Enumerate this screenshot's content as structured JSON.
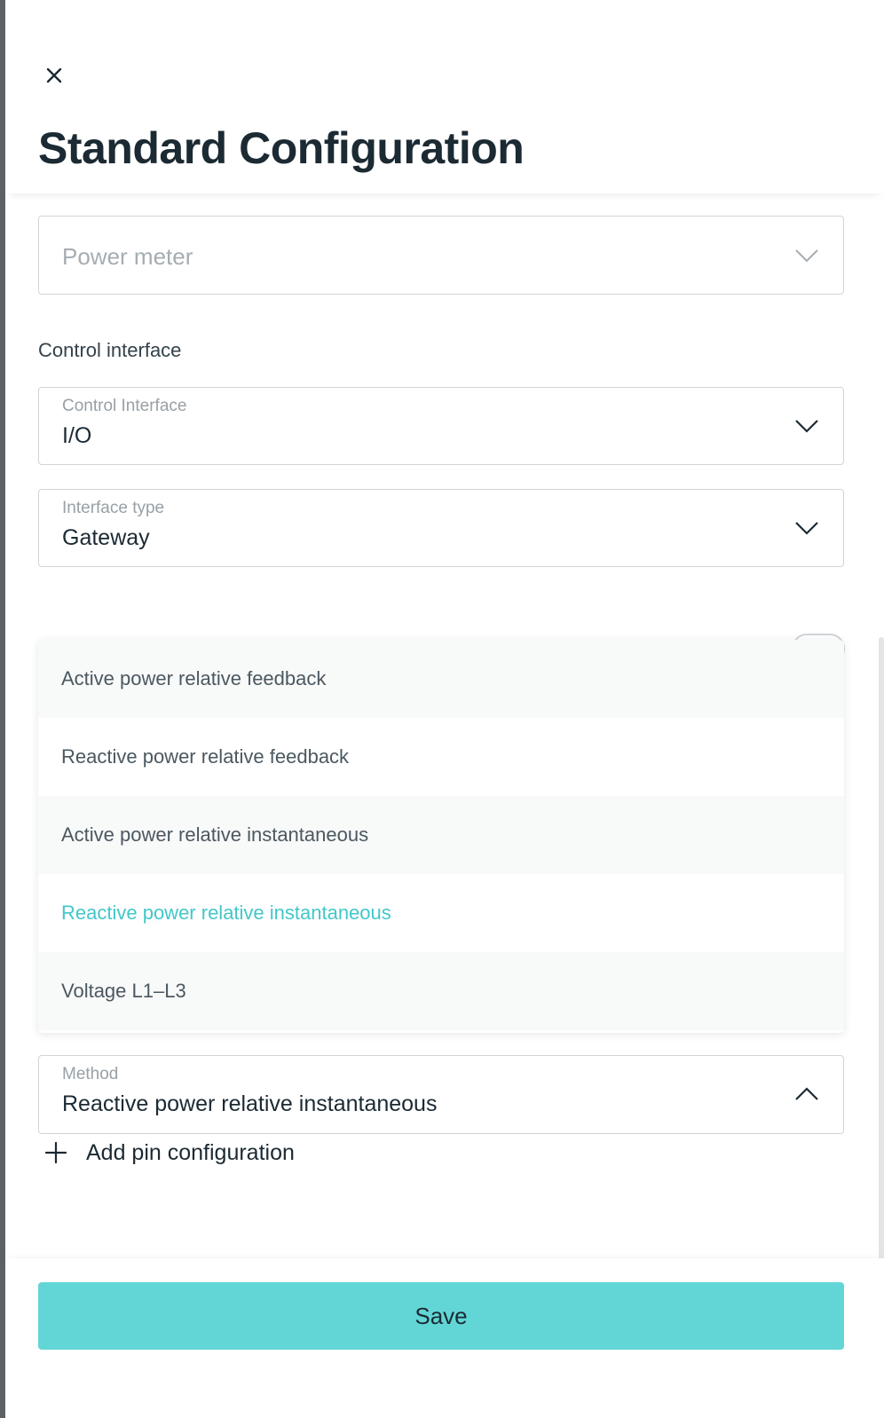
{
  "header": {
    "title": "Standard Configuration",
    "close_icon": "close-icon"
  },
  "power_meter_field": {
    "placeholder": "Power meter",
    "icon": "chevron-down-icon"
  },
  "control_section": {
    "heading": "Control interface"
  },
  "control_interface_field": {
    "label": "Control Interface",
    "value": "I/O",
    "icon": "chevron-down-icon"
  },
  "interface_type_field": {
    "label": "Interface type",
    "value": "Gateway",
    "icon": "chevron-down-icon"
  },
  "method_dropdown": {
    "options": [
      "Active power relative feedback",
      "Reactive power relative feedback",
      "Active power relative instantaneous",
      "Reactive power relative instantaneous",
      "Voltage L1–L3"
    ],
    "selected_index": 3,
    "selected_color": "#43c7c9"
  },
  "method_field": {
    "label": "Method",
    "value": "Reactive power relative instantaneous",
    "icon": "chevron-up-icon"
  },
  "add_pin": {
    "label": "Add pin configuration",
    "icon": "plus-icon"
  },
  "footer": {
    "save_label": "Save",
    "save_color": "#62d6d6"
  }
}
